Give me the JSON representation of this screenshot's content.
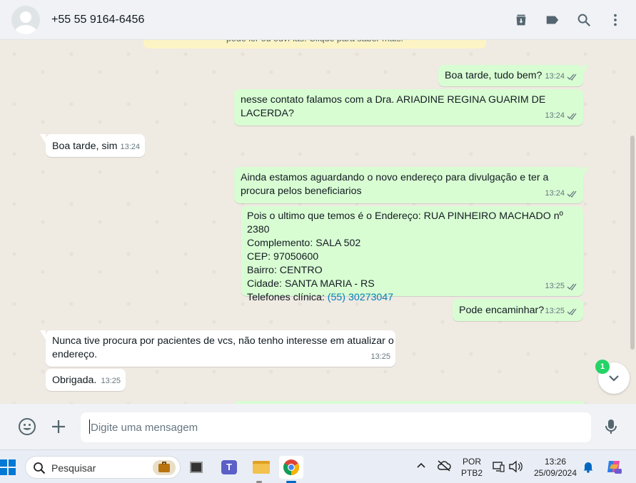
{
  "header": {
    "contact_name": "+55 55 9164-6456",
    "icons": [
      "archive-icon",
      "label-icon",
      "search-icon",
      "menu-icon"
    ]
  },
  "system_banner": "pode ler ou ouvi-las. Clique para saber mais.",
  "messages": [
    {
      "direction": "out",
      "lines": [
        "Boa tarde, tudo bem?"
      ],
      "time": "13:24"
    },
    {
      "direction": "out",
      "lines": [
        "nesse contato falamos com a Dra. ARIADINE REGINA GUARIM DE",
        "LACERDA?"
      ],
      "time": "13:24"
    },
    {
      "direction": "in",
      "lines": [
        "Boa tarde, sim"
      ],
      "time": "13:24"
    },
    {
      "direction": "out",
      "lines": [
        "Ainda estamos aguardando o novo endereço para divulgação e ter a",
        "procura pelos beneficiarios"
      ],
      "time": "13:24"
    },
    {
      "direction": "out",
      "lines": [
        "Pois o ultimo que temos é o Endereço: RUA PINHEIRO MACHADO nº 2380",
        "Complemento: SALA 502",
        "CEP: 97050600",
        "Bairro: CENTRO",
        "Cidade: SANTA MARIA - RS",
        "Telefones clínica: "
      ],
      "phone_link": "(55) 30273047",
      "time": "13:25"
    },
    {
      "direction": "out",
      "lines": [
        "Pode encaminhar?"
      ],
      "time": "13:25"
    },
    {
      "direction": "in",
      "lines": [
        "Nunca tive procura por pacientes de vcs, não tenho interesse em atualizar o",
        "endereço."
      ],
      "time": "13:25"
    },
    {
      "direction": "in",
      "lines": [
        "Obrigada."
      ],
      "time": "13:25"
    }
  ],
  "scroll_down": {
    "unread_count": "1"
  },
  "composer": {
    "placeholder": "Digite uma mensagem",
    "icons": [
      "emoji-icon",
      "attach-plus-icon",
      "microphone-icon"
    ]
  },
  "taskbar": {
    "search_label": "Pesquisar",
    "language_line1": "POR",
    "language_line2": "PTB2",
    "time": "13:26",
    "date": "25/09/2024",
    "colors": {
      "windows_blue": "#0078d4",
      "whatsapp_green": "#25d366",
      "outgoing_bubble": "#d9fdd3"
    }
  }
}
